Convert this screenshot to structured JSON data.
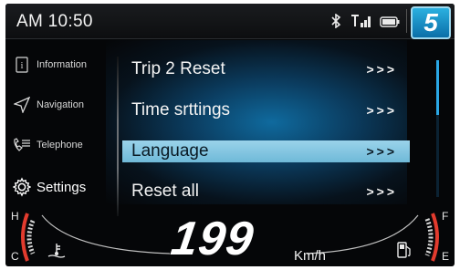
{
  "status": {
    "time": "AM 10:50",
    "icons": [
      "bluetooth-icon",
      "signal-icon",
      "battery-icon"
    ],
    "gear": "5"
  },
  "sidebar": {
    "items": [
      {
        "label": "Information",
        "icon": "info-icon"
      },
      {
        "label": "Navigation",
        "icon": "navigation-icon"
      },
      {
        "label": "Telephone",
        "icon": "phone-icon"
      },
      {
        "label": "Settings",
        "icon": "gear-icon",
        "active": true
      }
    ]
  },
  "menu": {
    "items": [
      {
        "label": "Trip 2 Reset",
        "arrows": ">>>"
      },
      {
        "label": "Time srttings",
        "arrows": ">>>"
      },
      {
        "label": "Language",
        "arrows": ">>>",
        "selected": true
      },
      {
        "label": "Reset all",
        "arrows": ">>>"
      }
    ]
  },
  "gauges": {
    "speed": "199",
    "unit": "Km/h",
    "temp_high": "H",
    "temp_low": "C",
    "fuel_full": "F",
    "fuel_empty": "E"
  },
  "colors": {
    "accent": "#2aa7e6",
    "selection": "#8ccbe5",
    "warning_red": "#e23b2e",
    "badge": "#1b8cc5"
  }
}
